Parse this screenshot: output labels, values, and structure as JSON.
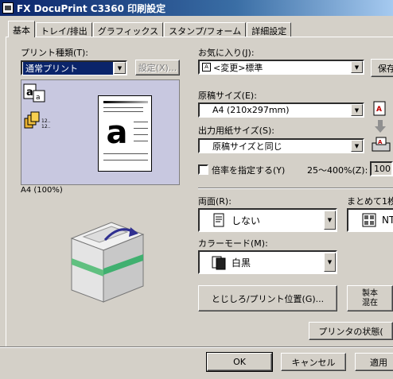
{
  "window": {
    "title": "FX DocuPrint C3360 印刷設定"
  },
  "tabs": [
    {
      "label": "基本"
    },
    {
      "label": "トレイ/排出"
    },
    {
      "label": "グラフィックス"
    },
    {
      "label": "スタンプ/フォーム"
    },
    {
      "label": "詳細設定"
    }
  ],
  "print_type": {
    "label": "プリント種類(T):",
    "value": "通常プリント",
    "settings_button": "設定(X)..."
  },
  "preview": {
    "caption": "A4 (100%)",
    "letter": "a",
    "tray_text": "12..\n12.."
  },
  "favorites": {
    "label": "お気に入り(J):",
    "value": "<変更>標準",
    "save_button": "保存"
  },
  "original_size": {
    "label": "原稿サイズ(E):",
    "value": "A4 (210x297mm)"
  },
  "output_size": {
    "label": "出力用紙サイズ(S):",
    "value": "原稿サイズと同じ"
  },
  "zoom": {
    "checkbox_label": "倍率を指定する(Y)",
    "range_label": "25〜400%(Z):",
    "value": "100"
  },
  "duplex": {
    "label": "両面(R):",
    "value": "しない"
  },
  "nup": {
    "label": "まとめて1枚",
    "value": "NT"
  },
  "color_mode": {
    "label": "カラーモード(M):",
    "value": "白黒"
  },
  "binding_button": "とじしろ/プリント位置(G)...",
  "extra_button": "製本\n混在",
  "printer_status_button": "プリンタの状態(",
  "footer": {
    "ok": "OK",
    "cancel": "キャンセル",
    "apply": "適用"
  }
}
